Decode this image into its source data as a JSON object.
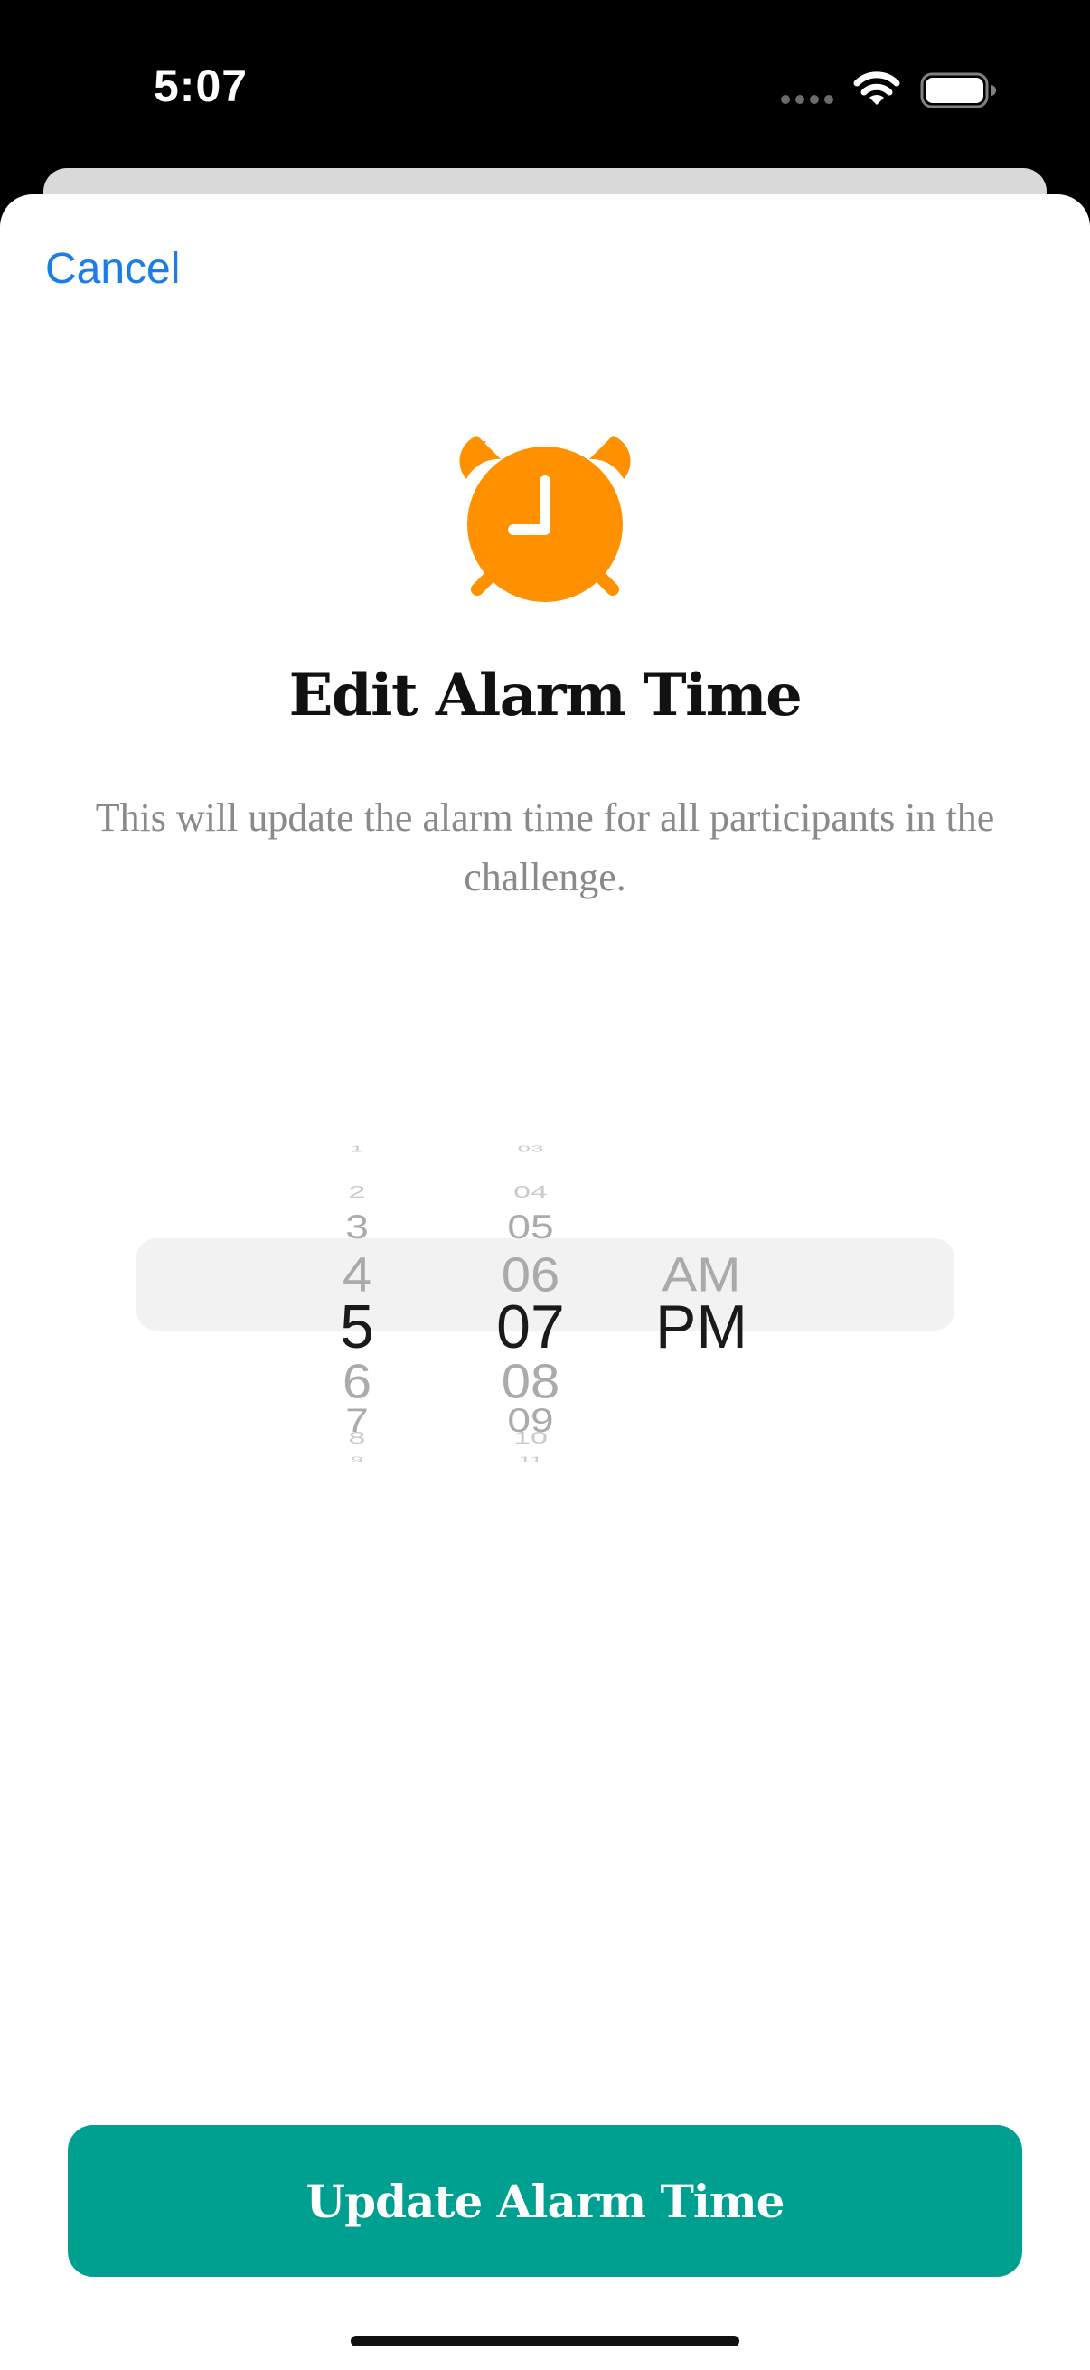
{
  "status_bar": {
    "time": "5:07"
  },
  "sheet": {
    "cancel_label": "Cancel",
    "icon": "alarm-clock-icon",
    "title": "Edit Alarm Time",
    "subtitle": "This will update the alarm time for all participants in the challenge."
  },
  "picker": {
    "hours": [
      "1",
      "2",
      "3",
      "4",
      "5",
      "6",
      "7",
      "8",
      "9"
    ],
    "minutes": [
      "03",
      "04",
      "05",
      "06",
      "07",
      "08",
      "09",
      "10",
      "11"
    ],
    "periods": [
      "AM",
      "PM"
    ],
    "selected": {
      "hour": "5",
      "minute": "07",
      "period": "PM"
    }
  },
  "update_button": {
    "label": "Update Alarm Time"
  },
  "colors": {
    "accent_blue": "#1a7ee6",
    "alarm_orange": "#ff9000",
    "button_teal": "#00a091"
  }
}
